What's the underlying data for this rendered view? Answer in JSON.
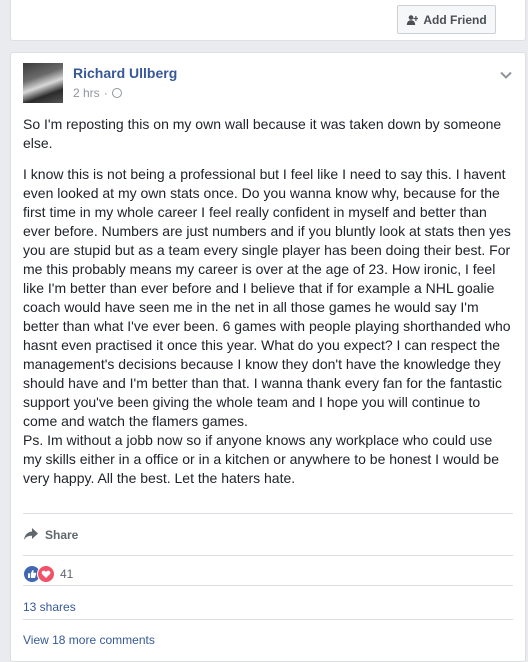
{
  "top": {
    "add_friend_label": "Add Friend"
  },
  "post": {
    "author": "Richard Ullberg",
    "time": "2 hrs",
    "separator": "·",
    "paragraph_1": "So I'm reposting this on my own wall because it was taken down by someone else.",
    "paragraph_2": "I know this is not being a professional but I feel like I need to say this. I havent even looked at my own stats once. Do you wanna know why, because for the first time in my whole career I feel really confident in myself and better than ever before. Numbers are just numbers and if you bluntly look at stats then yes you are stupid but as a team every single player has been doing their best. For me this probably means my career is over at the age of 23. How ironic, I feel like I'm better than ever before and I believe that if for example a NHL goalie coach would have seen me in the net in all those games he would say I'm better than what I've ever been. 6 games with people playing shorthanded who hasnt even practised it once this year. What do you expect? I can respect the management's decisions because I know they don't have the knowledge they should have and I'm better than that. I wanna thank every fan for the fantastic support you've been giving the whole team and I hope you will continue to come and watch the flamers games.",
    "paragraph_3": "Ps. Im without a jobb now so if anyone knows any workplace who could use my skills either in a office or in a kitchen or anywhere to be honest I would be very happy. All the best. Let the haters hate.",
    "share_label": "Share",
    "reaction_count": "41",
    "shares_label": "13 shares",
    "comments_label": "View 18 more comments"
  },
  "icons": {
    "add_friend": "add-friend-icon",
    "privacy": "globe-icon",
    "options": "chevron-down-icon",
    "share": "share-arrow-icon",
    "reactions": [
      "like-reaction-icon",
      "love-reaction-icon"
    ]
  },
  "colors": {
    "link": "#365899",
    "like": "#4267b2",
    "love": "#f25268",
    "background": "#e9ebee"
  }
}
